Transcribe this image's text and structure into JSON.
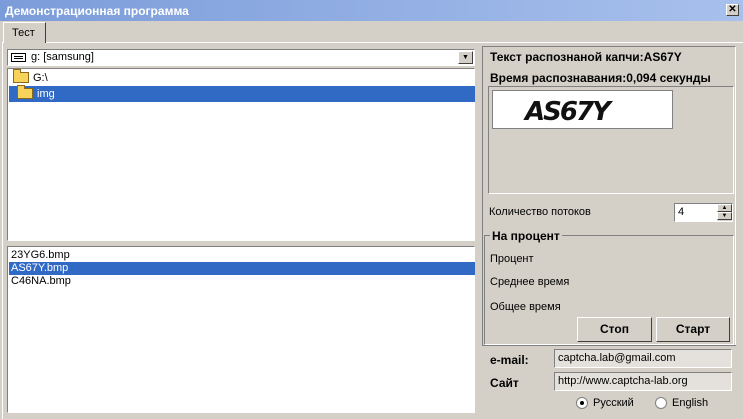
{
  "window": {
    "title": "Демонстрационная программа",
    "close_glyph": "✕"
  },
  "tabs": [
    {
      "label": "Тест"
    }
  ],
  "drive_select": {
    "value": "g: [samsung]",
    "arrow_glyph": "▼"
  },
  "directories": [
    {
      "label": "G:\\",
      "selected": false
    },
    {
      "label": "img",
      "selected": true
    }
  ],
  "files": [
    {
      "name": "23YG6.bmp",
      "selected": false
    },
    {
      "name": "AS67Y.bmp",
      "selected": true
    },
    {
      "name": "C46NA.bmp",
      "selected": false
    }
  ],
  "result": {
    "recognized_text": "Текст распознаной капчи:AS67Y",
    "recognition_time": "Время распознавания:0,094 секунды",
    "captcha_image_text": "AS67Y"
  },
  "threads": {
    "label": "Количество потоков",
    "value": "4"
  },
  "progress_group": {
    "title": "На процент",
    "percent_label": "Процент",
    "avg_time_label": "Среднее время",
    "total_time_label": "Общее время"
  },
  "buttons": {
    "stop": "Стоп",
    "start": "Старт"
  },
  "contacts": {
    "email_label": "e-mail:",
    "email_value": "captcha.lab@gmail.com",
    "site_label": "Сайт",
    "site_value": "http://www.captcha-lab.org"
  },
  "language": {
    "options": [
      {
        "label": "Русский",
        "checked": true
      },
      {
        "label": "English",
        "checked": false
      }
    ]
  },
  "colors": {
    "selection": "#316ac5",
    "face": "#d4d0c8",
    "titlebar": "#7b9cda"
  }
}
